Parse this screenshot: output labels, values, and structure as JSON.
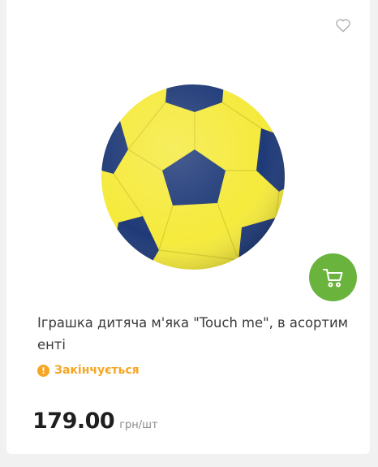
{
  "product": {
    "title": "Іграшка дитяча м'яка \"Touch me\", в асортим енті",
    "status": "Закінчується",
    "price": "179.00",
    "unit": "грн/шт",
    "image": "yellow-blue-soft-ball"
  },
  "icons": {
    "favorite": "heart-outline-icon",
    "cart": "shopping-cart-icon",
    "status": "exclamation-circle-icon"
  },
  "colors": {
    "accent_green": "#6ab43e",
    "warning_orange": "#f6a623",
    "ball_yellow": "#f5ea3c",
    "ball_blue": "#1f3a78"
  }
}
